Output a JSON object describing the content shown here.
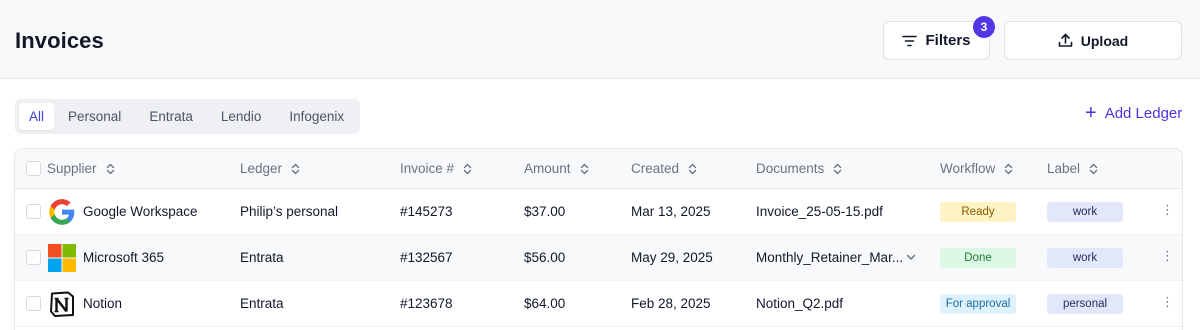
{
  "header": {
    "title": "Invoices",
    "filters_label": "Filters",
    "filters_count": "3",
    "upload_label": "Upload"
  },
  "tabs": [
    {
      "label": "All",
      "active": true
    },
    {
      "label": "Personal",
      "active": false
    },
    {
      "label": "Entrata",
      "active": false
    },
    {
      "label": "Lendio",
      "active": false
    },
    {
      "label": "Infogenix",
      "active": false
    }
  ],
  "add_ledger_label": "Add Ledger",
  "columns": {
    "supplier": "Supplier",
    "ledger": "Ledger",
    "invoice": "Invoice #",
    "amount": "Amount",
    "created": "Created",
    "documents": "Documents",
    "workflow": "Workflow",
    "label": "Label"
  },
  "rows": [
    {
      "supplier": "Google Workspace",
      "logo": "google-logo-icon",
      "ledger": "Philip’s personal",
      "invoice": "#145273",
      "amount": "$37.00",
      "created": "Mar 13, 2025",
      "document": "Invoice_25-05-15.pdf",
      "workflow": "Ready",
      "label": "work"
    },
    {
      "supplier": "Microsoft 365",
      "logo": "microsoft-logo-icon",
      "ledger": "Entrata",
      "invoice": "#132567",
      "amount": "$56.00",
      "created": "May 29, 2025",
      "document": "Monthly_Retainer_Mar...",
      "workflow": "Done",
      "label": "work"
    },
    {
      "supplier": "Notion",
      "logo": "notion-logo-icon",
      "ledger": "Entrata",
      "invoice": "#123678",
      "amount": "$64.00",
      "created": "Feb 28, 2025",
      "document": "Notion_Q2.pdf",
      "workflow": "For approval",
      "label": "personal"
    }
  ],
  "colors": {
    "accent": "#4a33e0",
    "badge": "#5436e8",
    "workflow_ready_bg": "#fdf3c4",
    "workflow_ready_fg": "#8a5a00",
    "workflow_done_bg": "#dcf7e3",
    "workflow_done_fg": "#1f7a3a",
    "workflow_approval_bg": "#dff1fb",
    "workflow_approval_fg": "#1b6fa6",
    "label_bg": "#e3e7fb",
    "label_fg": "#1f2a5a"
  }
}
